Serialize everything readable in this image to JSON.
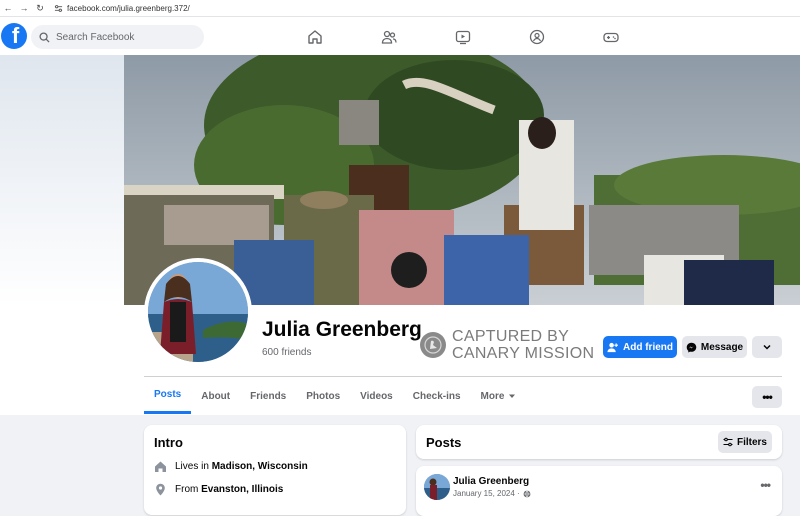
{
  "browser": {
    "url": "facebook.com/julia.greenberg.372/"
  },
  "header": {
    "logo_letter": "f",
    "search_placeholder": "Search Facebook",
    "nav_icons": [
      "home-icon",
      "friends-icon",
      "watch-icon",
      "groups-icon",
      "gaming-icon"
    ]
  },
  "profile": {
    "name": "Julia Greenberg",
    "friends": "600 friends",
    "watermark_line1": "CAPTURED BY",
    "watermark_line2": "CANARY MISSION"
  },
  "actions": {
    "add_friend": "Add friend",
    "message": "Message"
  },
  "tabs": [
    "Posts",
    "About",
    "Friends",
    "Photos",
    "Videos",
    "Check-ins",
    "More"
  ],
  "intro": {
    "title": "Intro",
    "lives_prefix": "Lives in ",
    "lives_place": "Madison, Wisconsin",
    "from_prefix": "From ",
    "from_place": "Evanston, Illinois"
  },
  "posts": {
    "title": "Posts",
    "filters": "Filters",
    "first_post": {
      "author": "Julia Greenberg",
      "date": "January 15, 2024 ·"
    }
  },
  "colors": {
    "brand": "#1877f2",
    "background": "#f0f2f5",
    "secondary_button": "#e4e6eb"
  }
}
